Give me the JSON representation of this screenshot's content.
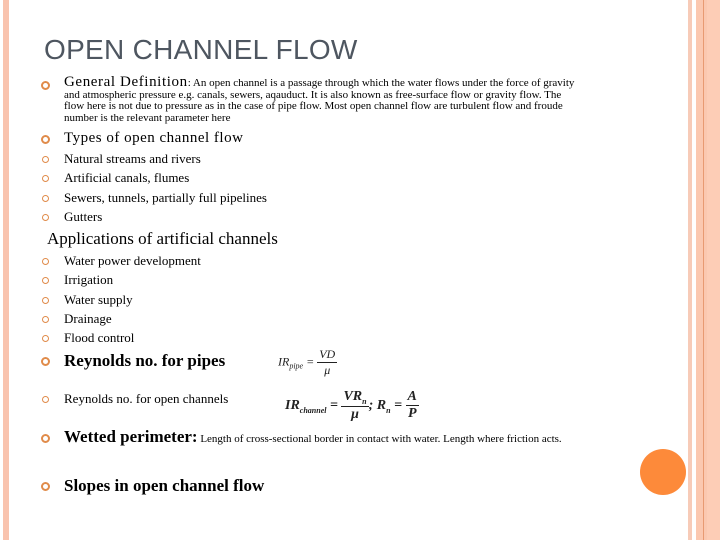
{
  "slide": {
    "title": "OPEN CHANNEL FLOW",
    "definition": {
      "lead": "General Definition",
      "lines": [
        ": An  open channel is a passage through which the water flows under the force of gravity",
        "and atmospheric pressure e.g. canals, sewers, aqauduct. It is also known as free-surface flow or gravity flow. The",
        "flow here is not due to pressure as in the case of pipe flow. Most open channel flow are turbulent flow and froude",
        "number is the relevant parameter here"
      ]
    },
    "types_heading": "Types of open channel flow",
    "types": [
      "Natural streams and rivers",
      "Artificial canals, flumes",
      "Sewers, tunnels, partially full pipelines",
      "Gutters"
    ],
    "applications_heading": "Applications of artificial channels",
    "applications": [
      "Water power development",
      "Irrigation",
      "Water supply",
      "Drainage",
      "Flood control"
    ],
    "reynolds_pipes": "Reynolds no. for pipes",
    "reynolds_channels": "Reynolds no. for open channels",
    "formula_pipe": {
      "lhs": "IR",
      "sub": "pipe",
      "num": "VD",
      "den": "μ"
    },
    "formula_channel": {
      "lhs": "IR",
      "sub": "channel",
      "num": "VR",
      "num_sub": "n",
      "den": "μ",
      "sep": "; ",
      "r": "R",
      "r_sub": "n",
      "r_num": "A",
      "r_den": "P"
    },
    "wetted_lead": "Wetted perimeter:",
    "wetted_text": " Length of cross-sectional border in contact with water.  Length where friction acts.",
    "slopes": "Slopes in open channel flow"
  },
  "colors": {
    "accent": "#fd8a3a",
    "band": "#f9c3ae",
    "title": "#4e5660",
    "bullet": "#e08b4a"
  }
}
